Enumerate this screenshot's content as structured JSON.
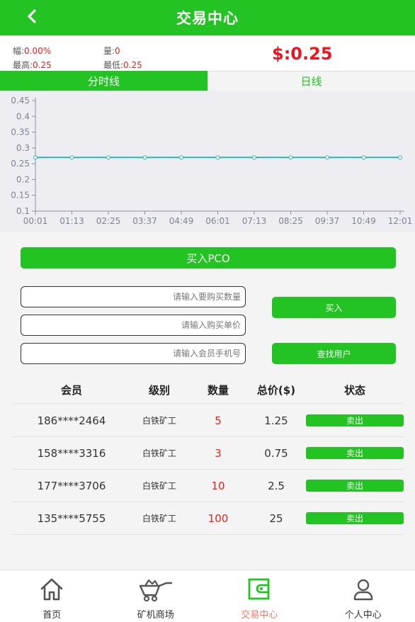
{
  "header": {
    "title": "交易中心"
  },
  "stats": {
    "change_label": "幅:",
    "change_value": "0.00%",
    "volume_label": "量:",
    "volume_value": "0",
    "high_label": "最高:",
    "high_value": "0.25",
    "low_label": "最低:",
    "low_value": "0.25",
    "price": "$:0.25"
  },
  "tabs": {
    "intraday": "分时线",
    "daily": "日线"
  },
  "chart_data": {
    "type": "line",
    "x": [
      "00:01",
      "01:13",
      "02:25",
      "03:37",
      "04:49",
      "06:01",
      "07:13",
      "08:25",
      "09:37",
      "10:49",
      "12:01"
    ],
    "series": [
      {
        "values": [
          0.27,
          0.27,
          0.27,
          0.27,
          0.27,
          0.27,
          0.27,
          0.27,
          0.27,
          0.27,
          0.27
        ]
      }
    ],
    "yticks": [
      "0.45",
      "0.4",
      "0.35",
      "0.3",
      "0.25",
      "0.2",
      "0.15",
      "0.1"
    ],
    "ylim": [
      0.1,
      0.45
    ],
    "grid": false,
    "line_color": "#2bb5b8"
  },
  "buy_section": {
    "title_button": "买入PCO",
    "quantity_placeholder": "请输入要购买数量",
    "unit_price_placeholder": "请输入购买单价",
    "phone_placeholder": "请输入会员手机号",
    "buy_button": "买入",
    "find_user_button": "查找用户"
  },
  "table": {
    "headers": [
      "会员",
      "级别",
      "数量",
      "总价($)",
      "状态"
    ],
    "rows": [
      {
        "member": "186****2464",
        "level": "白铁矿工",
        "quantity": "5",
        "total": "1.25",
        "status": "卖出"
      },
      {
        "member": "158****3316",
        "level": "白铁矿工",
        "quantity": "3",
        "total": "0.75",
        "status": "卖出"
      },
      {
        "member": "177****3706",
        "level": "白铁矿工",
        "quantity": "10",
        "total": "2.5",
        "status": "卖出"
      },
      {
        "member": "135****5755",
        "level": "白铁矿工",
        "quantity": "100",
        "total": "25",
        "status": "卖出"
      }
    ]
  },
  "nav": {
    "items": [
      {
        "label": "首页",
        "icon": "home-icon"
      },
      {
        "label": "矿机商场",
        "icon": "mining-cart-icon"
      },
      {
        "label": "交易中心",
        "icon": "wallet-icon"
      },
      {
        "label": "个人中心",
        "icon": "user-icon"
      }
    ],
    "active": 2
  },
  "colors": {
    "accent": "#22c322",
    "price_red": "#f0141e",
    "active_nav": "#f07a6a"
  }
}
